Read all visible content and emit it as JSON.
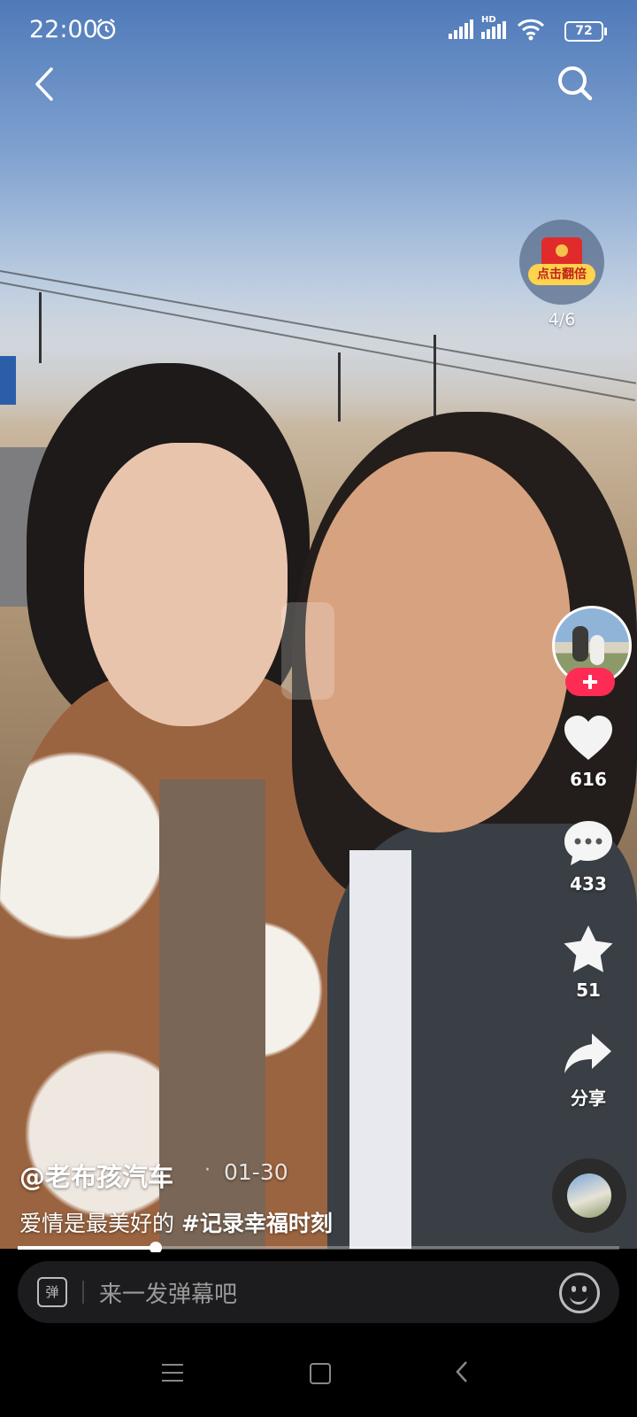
{
  "status_bar": {
    "time": "22:00",
    "battery": "72",
    "network": "HD"
  },
  "header": {
    "back_icon": "back-chevron-icon",
    "search_icon": "search-icon"
  },
  "reward": {
    "tag": "点击翻倍",
    "progress": "4/6"
  },
  "actions": {
    "like_count": "616",
    "comment_count": "433",
    "favorite_count": "51",
    "share_label": "分享"
  },
  "video": {
    "author": "@老布孩汽车",
    "separator": "·",
    "date": "01-30",
    "caption_text": "爱情是最美好的 ",
    "caption_tag": "#记录幸福时刻",
    "progress_fraction": 0.23
  },
  "comment_bar": {
    "danmu_icon_text": "弹",
    "placeholder": "来一发弹幕吧"
  },
  "colors": {
    "follow": "#fe2c55",
    "reward_tag": "#ffd34d",
    "red_envelope": "#e12b2b"
  }
}
